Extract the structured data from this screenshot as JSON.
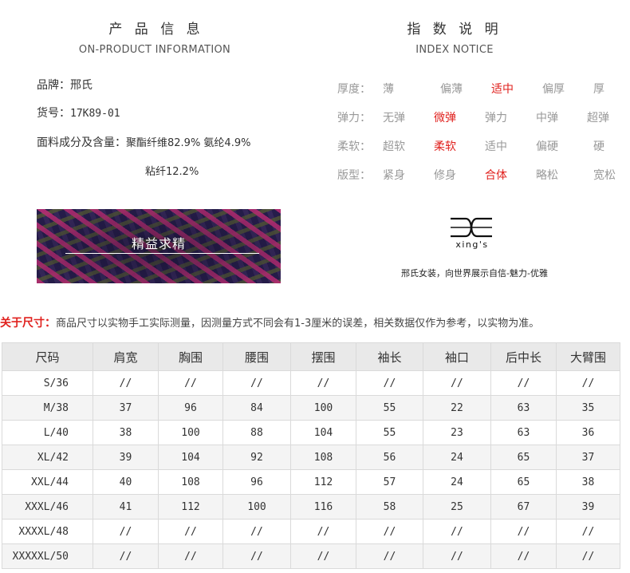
{
  "product_info": {
    "title": "产 品 信 息",
    "subtitle": "ON-PRODUCT INFORMATION",
    "brand": "品牌：邢氏",
    "item_no_label": "货号：",
    "item_no": "17K89-01",
    "fabric_label": "面料成分及含量：",
    "fabric_line1": "聚酯纤维82.9% 氨纶4.9%",
    "fabric_line2": "粘纤12.2%"
  },
  "index_notice": {
    "title": "指 数 说 明",
    "subtitle": "INDEX NOTICE",
    "rows": [
      {
        "label": "厚度：",
        "options": [
          "薄",
          "偏薄",
          "适中",
          "偏厚",
          "厚"
        ],
        "selected": "适中"
      },
      {
        "label": "弹力：",
        "options": [
          "无弹",
          "微弹",
          "弹力",
          "中弹",
          "超弹"
        ],
        "selected": "微弹"
      },
      {
        "label": "柔软：",
        "options": [
          "超软",
          "柔软",
          "适中",
          "偏硬",
          "硬"
        ],
        "selected": "柔软"
      },
      {
        "label": "版型：",
        "options": [
          "紧身",
          "修身",
          "合体",
          "略松",
          "宽松"
        ],
        "selected": "合体"
      }
    ]
  },
  "banner": {
    "text": "精益求精"
  },
  "brand_logo": {
    "wordmark": "xing's",
    "slogan": "邢氏女装，向世界展示自信-魅力-优雅"
  },
  "size_note": {
    "label": "关于尺寸：",
    "text": "商品尺寸以实物手工实际测量，因测量方式不同会有1-3厘米的误差，相关数据仅作为参考，以实物为准。"
  },
  "size_table": {
    "headers": [
      "尺码",
      "肩宽",
      "胸围",
      "腰围",
      "摆围",
      "袖长",
      "袖口",
      "后中长",
      "大臂围"
    ],
    "rows": [
      [
        "S/36",
        "//",
        "//",
        "//",
        "//",
        "//",
        "//",
        "//",
        "//"
      ],
      [
        "M/38",
        "37",
        "96",
        "84",
        "100",
        "55",
        "22",
        "63",
        "35"
      ],
      [
        "L/40",
        "38",
        "100",
        "88",
        "104",
        "55",
        "23",
        "63",
        "36"
      ],
      [
        "XL/42",
        "39",
        "104",
        "92",
        "108",
        "56",
        "24",
        "65",
        "37"
      ],
      [
        "XXL/44",
        "40",
        "108",
        "96",
        "112",
        "57",
        "24",
        "65",
        "38"
      ],
      [
        "XXXL/46",
        "41",
        "112",
        "100",
        "116",
        "58",
        "25",
        "67",
        "39"
      ],
      [
        "XXXXL/48",
        "//",
        "//",
        "//",
        "//",
        "//",
        "//",
        "//",
        "//"
      ],
      [
        "XXXXXL/50",
        "//",
        "//",
        "//",
        "//",
        "//",
        "//",
        "//",
        "//"
      ]
    ]
  },
  "colors": {
    "accent": "#e0211e",
    "table_header_bg": "#e9e9e9",
    "muted_text": "#999999"
  }
}
